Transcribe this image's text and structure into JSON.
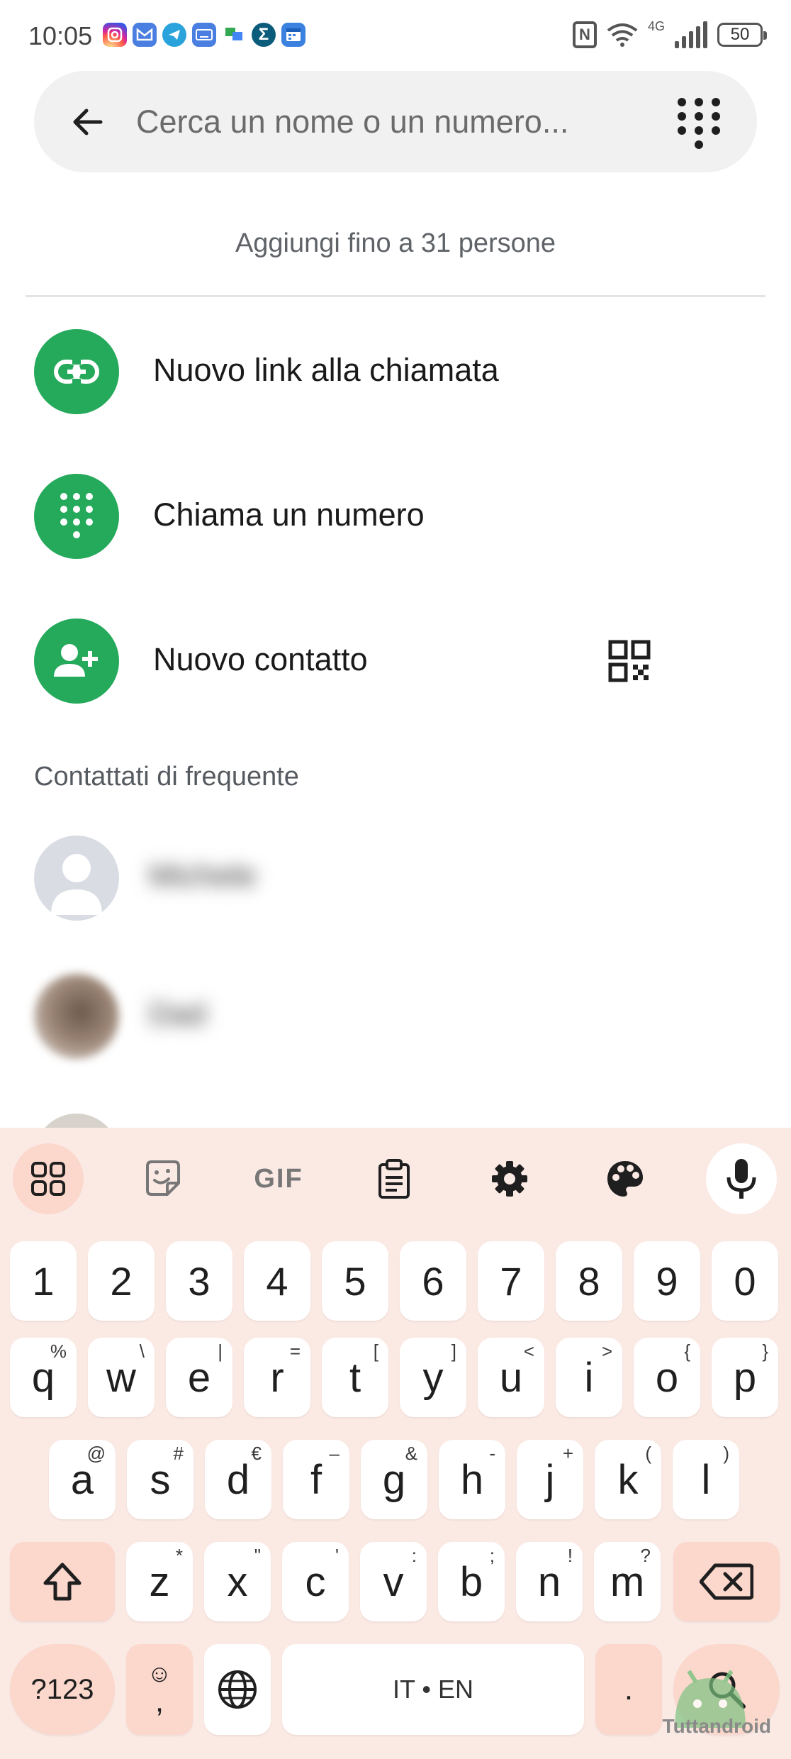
{
  "status_bar": {
    "time": "10:05",
    "network": "4G",
    "battery": "50",
    "nfc": "N",
    "app_icons": [
      "instagram-icon",
      "gmail-icon",
      "telegram-icon",
      "keyboard-app-icon",
      "translate-app-icon",
      "sum-app-icon",
      "calendar-app-icon"
    ]
  },
  "search": {
    "placeholder": "Cerca un nome o un numero..."
  },
  "hint": "Aggiungi fino a 31 persone",
  "actions": [
    {
      "label": "Nuovo link alla chiamata",
      "icon": "link-icon"
    },
    {
      "label": "Chiama un numero",
      "icon": "dialpad-icon"
    },
    {
      "label": "Nuovo contatto",
      "icon": "add-person-icon",
      "extra_icon": "qr-code-icon"
    }
  ],
  "frequent": {
    "title": "Contattati di frequente",
    "contacts": [
      {
        "name": "Michele",
        "blurred": true
      },
      {
        "name": "Dad",
        "blurred": true
      }
    ]
  },
  "keyboard": {
    "toolbar": [
      "apps-grid-icon",
      "sticker-icon",
      "GIF",
      "clipboard-icon",
      "settings-icon",
      "palette-icon",
      "microphone-icon"
    ],
    "gif_label": "GIF",
    "row_numbers": [
      "1",
      "2",
      "3",
      "4",
      "5",
      "6",
      "7",
      "8",
      "9",
      "0"
    ],
    "row1": [
      {
        "k": "q",
        "s": "%"
      },
      {
        "k": "w",
        "s": "\\"
      },
      {
        "k": "e",
        "s": "|"
      },
      {
        "k": "r",
        "s": "="
      },
      {
        "k": "t",
        "s": "["
      },
      {
        "k": "y",
        "s": "]"
      },
      {
        "k": "u",
        "s": "<"
      },
      {
        "k": "i",
        "s": ">"
      },
      {
        "k": "o",
        "s": "{"
      },
      {
        "k": "p",
        "s": "}"
      }
    ],
    "row2": [
      {
        "k": "a",
        "s": "@"
      },
      {
        "k": "s",
        "s": "#"
      },
      {
        "k": "d",
        "s": "€"
      },
      {
        "k": "f",
        "s": "–"
      },
      {
        "k": "g",
        "s": "&"
      },
      {
        "k": "h",
        "s": "-"
      },
      {
        "k": "j",
        "s": "+"
      },
      {
        "k": "k",
        "s": "("
      },
      {
        "k": "l",
        "s": ")"
      }
    ],
    "row3": [
      {
        "k": "z",
        "s": "*"
      },
      {
        "k": "x",
        "s": "\""
      },
      {
        "k": "c",
        "s": "'"
      },
      {
        "k": "v",
        "s": ":"
      },
      {
        "k": "b",
        "s": ";"
      },
      {
        "k": "n",
        "s": "!"
      },
      {
        "k": "m",
        "s": "?"
      }
    ],
    "symbols_label": "?123",
    "emoji_comma": ",",
    "space_label": "IT • EN",
    "period": "."
  },
  "watermark": "Tuttandroid",
  "colors": {
    "accent_green": "#25a95b",
    "keyboard_bg": "#fbe9e4",
    "key_dark": "#fbd7cc"
  }
}
